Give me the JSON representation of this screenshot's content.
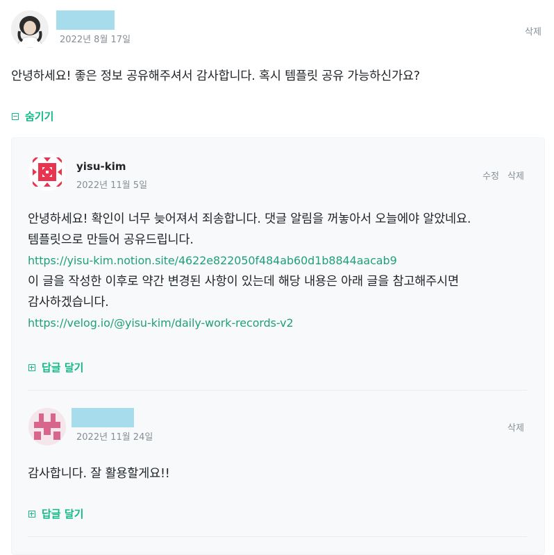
{
  "comment": {
    "username": "",
    "date": "2022년 8월 17일",
    "delete_label": "삭제",
    "text": "안녕하세요! 좋은 정보 공유해주셔서 감사합니다. 혹시 템플릿 공유 가능하신가요?",
    "hide_label": "숨기기"
  },
  "replies": [
    {
      "username": "yisu-kim",
      "date": "2022년 11월 5일",
      "edit_label": "수정",
      "delete_label": "삭제",
      "line1": "안녕하세요! 확인이 너무 늦어져서 죄송합니다. 댓글 알림을 꺼놓아서 오늘에야 알았네요.",
      "line2": "템플릿으로 만들어 공유드립니다.",
      "link1": "https://yisu-kim.notion.site/4622e822050f484ab60d1b8844aacab9",
      "line3": "이 글을 작성한 이후로 약간 변경된 사항이 있는데 해당 내용은 아래 글을 참고해주시면",
      "line4": "감사하겠습니다.",
      "link2": "https://velog.io/@yisu-kim/daily-work-records-v2",
      "reply_label": "답글 달기"
    },
    {
      "username": "",
      "date": "2022년 11월 24일",
      "delete_label": "삭제",
      "text": "감사합니다. 잘 활용할게요!!",
      "reply_label": "답글 달기"
    }
  ],
  "colors": {
    "accent": "#12b886",
    "link": "#20a07a",
    "muted": "#868e96",
    "mask": "#a6dcec"
  }
}
